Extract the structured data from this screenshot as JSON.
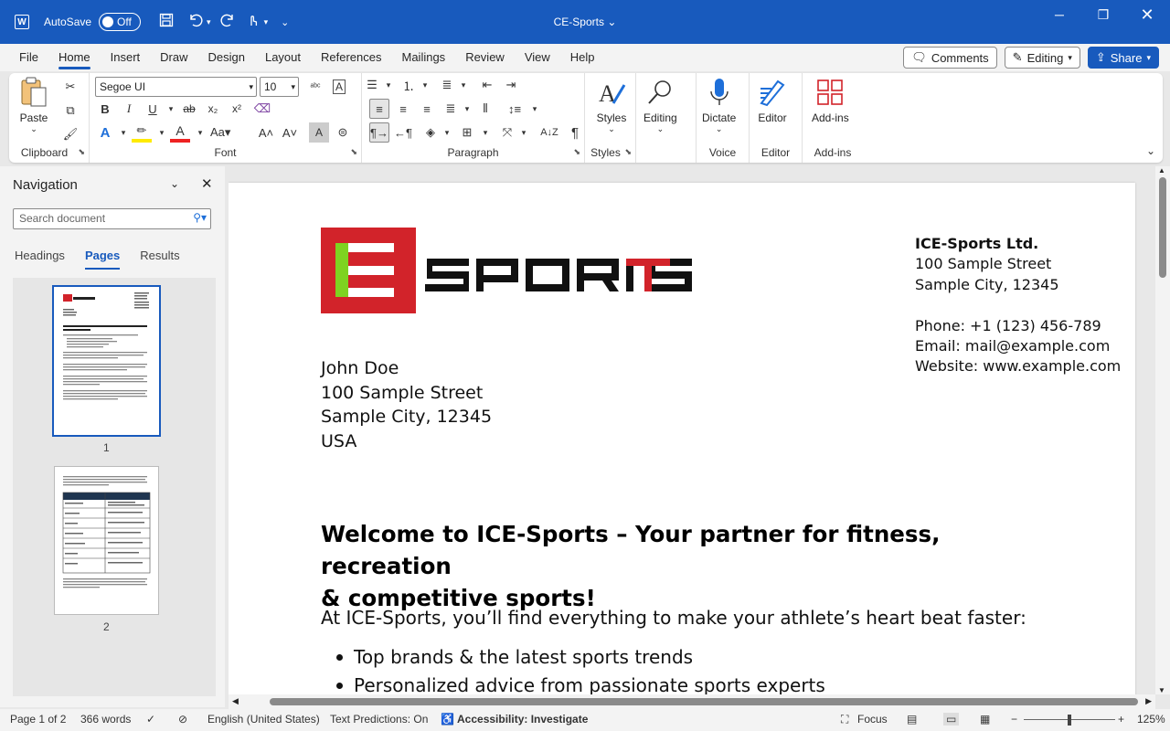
{
  "titlebar": {
    "autosave_label": "AutoSave",
    "autosave_state": "Off",
    "doc_title": "CE-Sports",
    "minimize_icon": "minimize-icon",
    "restore_icon": "restore-icon",
    "close_icon": "close-icon"
  },
  "tabs": [
    "File",
    "Home",
    "Insert",
    "Draw",
    "Design",
    "Layout",
    "References",
    "Mailings",
    "Review",
    "View",
    "Help"
  ],
  "active_tab": "Home",
  "tab_right": {
    "comments": "Comments",
    "editing": "Editing",
    "share": "Share"
  },
  "ribbon": {
    "clipboard": {
      "label": "Clipboard",
      "paste": "Paste"
    },
    "font": {
      "label": "Font",
      "family": "Segoe UI",
      "size": "10"
    },
    "paragraph": {
      "label": "Paragraph"
    },
    "styles": {
      "label": "Styles",
      "styles_btn": "Styles",
      "editing_btn": "Editing"
    },
    "voice": {
      "label": "Voice",
      "dictate": "Dictate"
    },
    "editor": {
      "label": "Editor",
      "editor_btn": "Editor"
    },
    "addins": {
      "label": "Add-ins",
      "addins_btn": "Add-ins"
    }
  },
  "navigation": {
    "title": "Navigation",
    "search_placeholder": "Search document",
    "tabs": [
      "Headings",
      "Pages",
      "Results"
    ],
    "active_tab": "Pages",
    "pages": [
      "1",
      "2"
    ]
  },
  "document": {
    "company": "ICE-Sports Ltd.",
    "company_street": "100 Sample Street",
    "company_city": "Sample City, 12345",
    "phone": "Phone: +1 (123) 456-789",
    "email": "Email: mail@example.com",
    "website": "Website: www.example.com",
    "recipient_name": "John Doe",
    "recipient_street": "100 Sample Street",
    "recipient_city": "Sample City, 12345",
    "recipient_country": "USA",
    "heading_line1": "Welcome to ICE-Sports – Your partner for fitness, recreation",
    "heading_line2": "& competitive sports!",
    "intro": "At ICE-Sports, you’ll find everything to make your athlete’s heart beat faster:",
    "bullets": [
      "Top brands & the latest sports trends",
      "Personalized advice from passionate sports experts"
    ],
    "logo_text": "SPORTS",
    "logo_colors": {
      "red": "#d2232a",
      "green": "#7ed321",
      "black": "#111111"
    }
  },
  "status": {
    "page": "Page 1 of 2",
    "words": "366 words",
    "language": "English (United States)",
    "predictions": "Text Predictions: On",
    "accessibility": "Accessibility: Investigate",
    "focus": "Focus",
    "zoom": "125%"
  },
  "colors": {
    "accent": "#185abd"
  }
}
